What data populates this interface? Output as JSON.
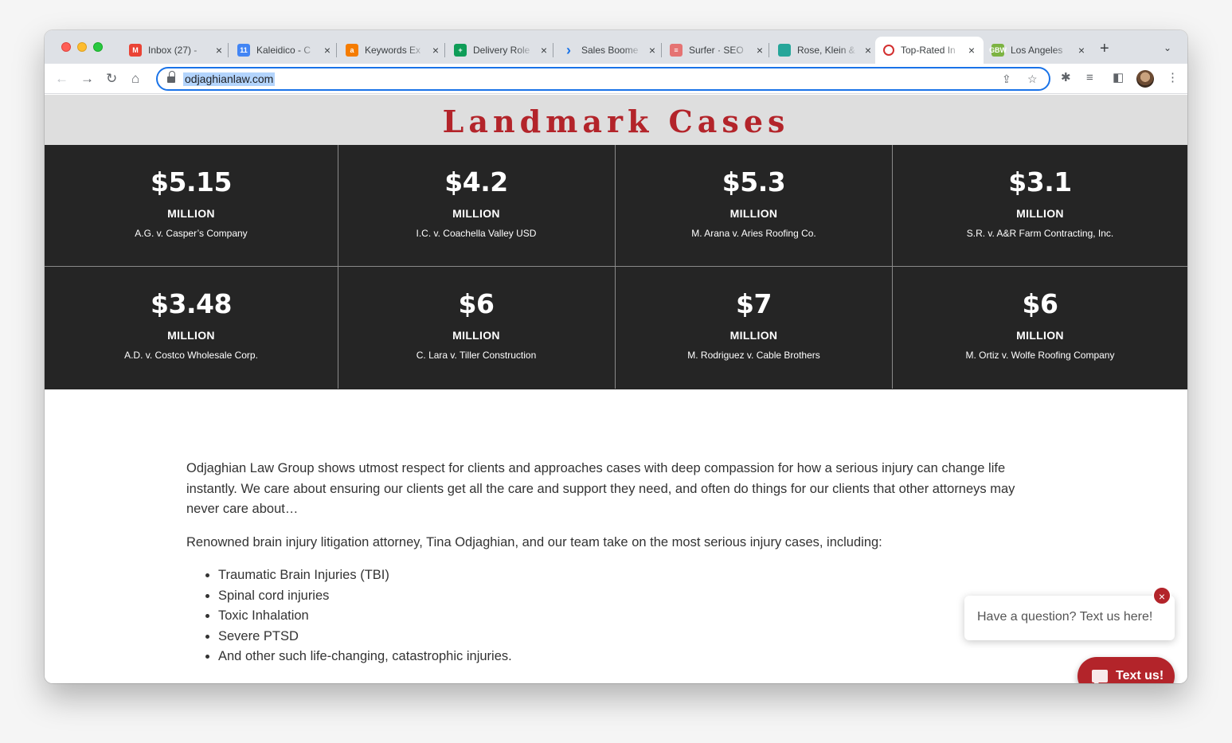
{
  "browser": {
    "tabs": [
      {
        "title": "Inbox (27) - ",
        "favicon": "gmail-icon",
        "color": "#ea4335",
        "glyph": "M"
      },
      {
        "title": "Kaleidico - C",
        "favicon": "calendar-icon",
        "color": "#4285f4",
        "glyph": "11"
      },
      {
        "title": "Keywords Ex",
        "favicon": "ahrefs-icon",
        "color": "#f57c00",
        "glyph": "a"
      },
      {
        "title": "Delivery Role",
        "favicon": "sheets-icon",
        "color": "#0f9d58",
        "glyph": "+"
      },
      {
        "title": "Sales Boome",
        "favicon": "chevron-right-icon",
        "color": "#1a73e8",
        "glyph": "›"
      },
      {
        "title": "Surfer · SEO",
        "favicon": "surfer-icon",
        "color": "#e57373",
        "glyph": "≡"
      },
      {
        "title": "Rose, Klein &",
        "favicon": "teal-square-icon",
        "color": "#26a69a",
        "glyph": ""
      },
      {
        "title": "Top-Rated In",
        "favicon": "opera-o-icon",
        "color": "#d32f2f",
        "glyph": "O"
      },
      {
        "title": "Los Angeles",
        "favicon": "gbw-icon",
        "color": "#7cb342",
        "glyph": "GBW"
      }
    ],
    "new_tab": "+",
    "tab_menu": "⌄",
    "url": "odjaghianlaw.com"
  },
  "page": {
    "heading": "Landmark Cases",
    "cases": [
      {
        "amount": "$5.15",
        "unit": "MILLION",
        "name": "A.G. v. Casper’s Company"
      },
      {
        "amount": "$4.2",
        "unit": "MILLION",
        "name": "I.C. v. Coachella Valley USD"
      },
      {
        "amount": "$5.3",
        "unit": "MILLION",
        "name": "M. Arana v. Aries Roofing Co."
      },
      {
        "amount": "$3.1",
        "unit": "MILLION",
        "name": "S.R. v. A&R Farm Contracting, Inc."
      },
      {
        "amount": "$3.48",
        "unit": "MILLION",
        "name": "A.D. v. Costco Wholesale Corp."
      },
      {
        "amount": "$6",
        "unit": "MILLION",
        "name": "C. Lara v. Tiller Construction"
      },
      {
        "amount": "$7",
        "unit": "MILLION",
        "name": "M. Rodriguez v. Cable Brothers"
      },
      {
        "amount": "$6",
        "unit": "MILLION",
        "name": "M. Ortiz v. Wolfe Roofing Company"
      }
    ],
    "intro": "Odjaghian Law Group shows utmost respect for clients and approaches cases with deep compassion for how a serious injury can change life instantly. We care about ensuring our clients get all the care and support they need, and often do things for our clients that other attorneys may never care about…",
    "lead": "Renowned brain injury litigation attorney, Tina Odjaghian, and our team take on the most serious injury cases, including:",
    "injuries": [
      "Traumatic Brain Injuries (TBI)",
      "Spinal cord injuries",
      "Toxic Inhalation",
      "Severe PTSD",
      "And other such life-changing, catastrophic injuries."
    ]
  },
  "chat": {
    "prompt": "Have a question? Text us here!",
    "close": "×",
    "button": "Text us!"
  }
}
